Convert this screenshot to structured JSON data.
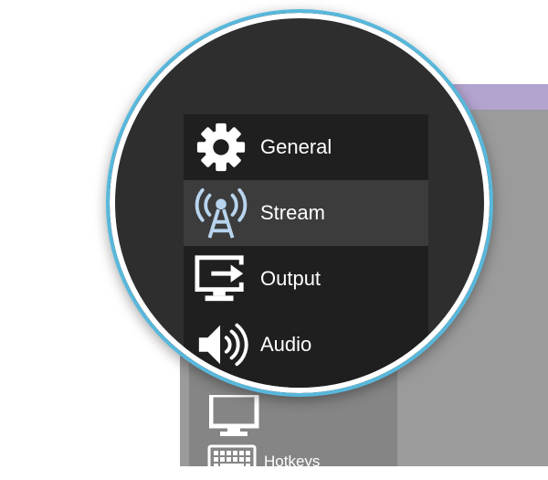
{
  "background_window": {
    "titlebar_color": "#b3a3cf",
    "sidebar_items": [
      {
        "icon": "display-icon",
        "label": ""
      },
      {
        "icon": "keyboard-icon",
        "label": "Hotkeys"
      }
    ]
  },
  "magnifier": {
    "border_color": "#58b8dc",
    "items": [
      {
        "icon": "gear-icon",
        "label": "General",
        "selected": false
      },
      {
        "icon": "broadcast-tower-icon",
        "label": "Stream",
        "selected": true
      },
      {
        "icon": "monitor-export-icon",
        "label": "Output",
        "selected": false
      },
      {
        "icon": "speaker-icon",
        "label": "Audio",
        "selected": false
      }
    ]
  }
}
